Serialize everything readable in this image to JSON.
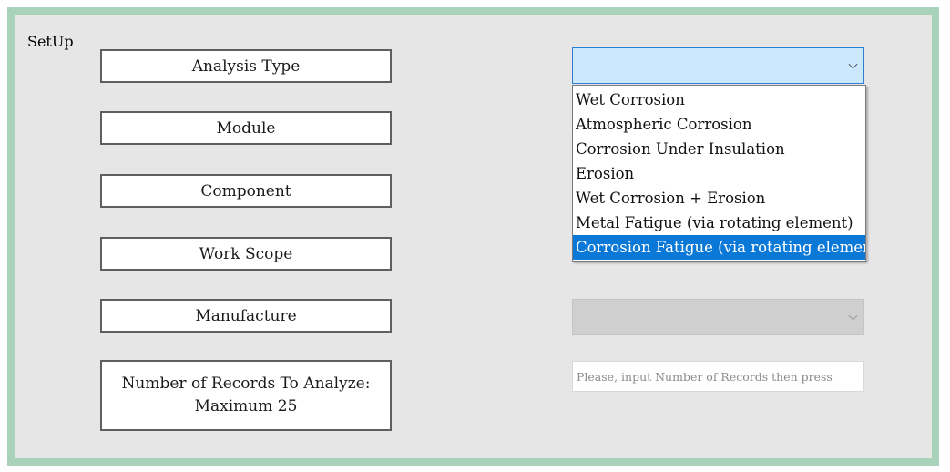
{
  "form": {
    "title": "SetUp",
    "labels": {
      "analysis_type": "Analysis Type",
      "module": "Module",
      "component": "Component",
      "work_scope": "Work Scope",
      "manufacture": "Manufacture",
      "records_line1": "Number of Records To Analyze:",
      "records_line2": "Maximum 25"
    },
    "analysis_type_dropdown": {
      "value": "",
      "options": [
        "Wet Corrosion",
        "Atmospheric Corrosion",
        "Corrosion Under Insulation",
        "Erosion",
        "Wet Corrosion + Erosion",
        "Metal Fatigue (via rotating element)",
        "Corrosion Fatigue (via rotating element)"
      ],
      "highlighted": "Corrosion Fatigue (via rotating element)"
    },
    "manufacture_dropdown": {
      "value": "",
      "state": "disabled"
    },
    "records_input": {
      "value": "",
      "placeholder": "Please, input Number of Records then press"
    },
    "colors": {
      "frame_border": "#a9d2ba",
      "background": "#e6e6e6",
      "selection": "#0a78d7",
      "combo_focus": "#cce8ff"
    }
  }
}
